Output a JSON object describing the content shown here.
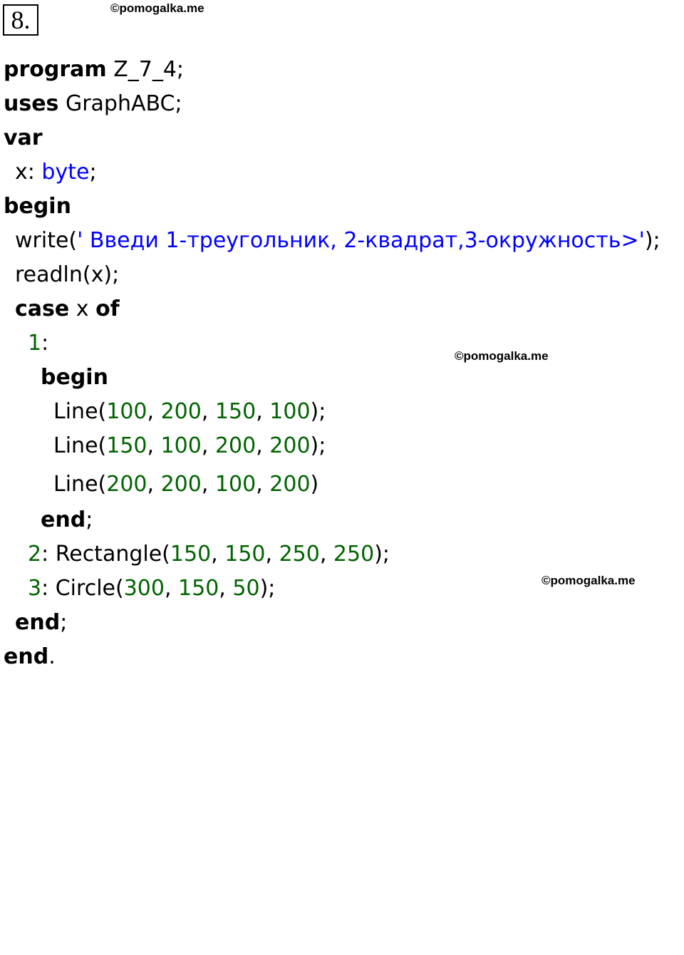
{
  "task_number": "8.",
  "watermarks": [
    "©pomogalka.me",
    "©pomogalka.me",
    "©pomogalka.me"
  ],
  "colors": {
    "keyword": "#000000",
    "type": "#0000ff",
    "string": "#0000ff",
    "number": "#006400"
  },
  "code": {
    "l1": {
      "kw": "program",
      "rest": " Z_7_4;"
    },
    "l2": {
      "kw": "uses",
      "rest": " GraphABC;"
    },
    "l3": {
      "kw": "var"
    },
    "l4": {
      "pre": "x: ",
      "type": "byte",
      "post": ";"
    },
    "l5": {
      "kw": "begin"
    },
    "l6": {
      "pre": "write(",
      "str": "' Введи 1-треугольник, 2-квадрат,3-окружность>'",
      "post": ");"
    },
    "l7": {
      "text": "readln(x);"
    },
    "l8": {
      "kw1": "case",
      "mid": " x ",
      "kw2": "of"
    },
    "l9": {
      "num": "1",
      "post": ":"
    },
    "l10": {
      "kw": "begin"
    },
    "l11": {
      "fn": "Line(",
      "a": "100",
      "b": "200",
      "c": "150",
      "d": "100",
      "end": ");"
    },
    "l12": {
      "fn": "Line(",
      "a": "150",
      "b": "100",
      "c": "200",
      "d": "200",
      "end": ");"
    },
    "l13": {
      "fn": "Line(",
      "a": "200",
      "b": "200",
      "c": "100",
      "d": "200",
      "end": ")"
    },
    "l14": {
      "kw": "end",
      "post": ";"
    },
    "l15": {
      "num": "2",
      "fn": ": Rectangle(",
      "a": "150",
      "b": "150",
      "c": "250",
      "d": "250",
      "end": ");"
    },
    "l16": {
      "num": "3",
      "fn": ": Circle(",
      "a": "300",
      "b": "150",
      "c": "50",
      "end": ");"
    },
    "l17": {
      "kw": "end",
      "post": ";"
    },
    "l18": {
      "kw": "end",
      "post": "."
    }
  }
}
